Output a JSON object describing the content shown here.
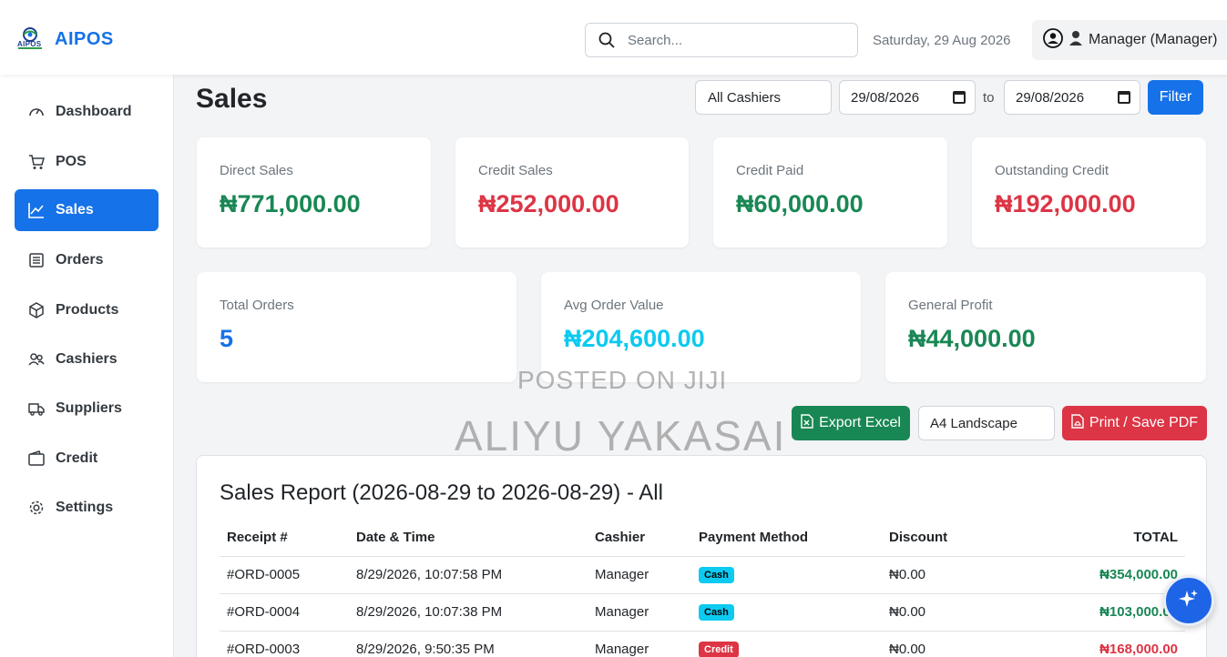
{
  "header": {
    "brand_name": "AIPOS",
    "brand_logo_text": "AIPOS",
    "search_placeholder": "Search...",
    "date": "Saturday, 29 Aug 2026",
    "user_label": "Manager (Manager)"
  },
  "sidebar": {
    "items": [
      {
        "label": "Dashboard",
        "icon": "speedometer-icon",
        "active": false
      },
      {
        "label": "POS",
        "icon": "cart-icon",
        "active": false
      },
      {
        "label": "Sales",
        "icon": "chart-line-icon",
        "active": true
      },
      {
        "label": "Orders",
        "icon": "list-icon",
        "active": false
      },
      {
        "label": "Products",
        "icon": "box-icon",
        "active": false
      },
      {
        "label": "Cashiers",
        "icon": "people-icon",
        "active": false
      },
      {
        "label": "Suppliers",
        "icon": "truck-icon",
        "active": false
      },
      {
        "label": "Credit",
        "icon": "wallet-icon",
        "active": false
      },
      {
        "label": "Settings",
        "icon": "gear-icon",
        "active": false
      }
    ]
  },
  "page": {
    "title": "Sales",
    "filters": {
      "cashier": "All Cashiers",
      "from_date": "29/08/2026",
      "to_label": "to",
      "to_date": "29/08/2026",
      "filter_label": "Filter"
    }
  },
  "stats": {
    "direct_sales": {
      "label": "Direct Sales",
      "value": "₦771,000.00"
    },
    "credit_sales": {
      "label": "Credit Sales",
      "value": "₦252,000.00"
    },
    "credit_paid": {
      "label": "Credit Paid",
      "value": "₦60,000.00"
    },
    "outstanding_credit": {
      "label": "Outstanding Credit",
      "value": "₦192,000.00"
    },
    "total_orders": {
      "label": "Total Orders",
      "value": "5"
    },
    "avg_order_value": {
      "label": "Avg Order Value",
      "value": "₦204,600.00"
    },
    "general_profit": {
      "label": "General Profit",
      "value": "₦44,000.00"
    }
  },
  "actions": {
    "export_label": "Export Excel",
    "paper_size": "A4 Landscape",
    "print_label": "Print / Save PDF"
  },
  "report": {
    "title": "Sales Report (2026-08-29 to 2026-08-29) - All",
    "columns": [
      "Receipt #",
      "Date & Time",
      "Cashier",
      "Payment Method",
      "Discount",
      "TOTAL"
    ],
    "rows": [
      {
        "receipt": "#ORD-0005",
        "datetime": "8/29/2026, 10:07:58 PM",
        "cashier": "Manager",
        "method": "Cash",
        "discount": "₦0.00",
        "total": "₦354,000.00"
      },
      {
        "receipt": "#ORD-0004",
        "datetime": "8/29/2026, 10:07:38 PM",
        "cashier": "Manager",
        "method": "Cash",
        "discount": "₦0.00",
        "total": "₦103,000.00"
      },
      {
        "receipt": "#ORD-0003",
        "datetime": "8/29/2026, 9:50:35 PM",
        "cashier": "Manager",
        "method": "Credit",
        "discount": "₦0.00",
        "total": "₦168,000.00"
      }
    ]
  },
  "watermark": {
    "line1": "POSTED ON JIJI",
    "line2": "ALIYU YAKASAI"
  },
  "colors": {
    "primary": "#1572e8",
    "success": "#198754",
    "danger": "#dc3545",
    "info": "#0dcaf0"
  }
}
